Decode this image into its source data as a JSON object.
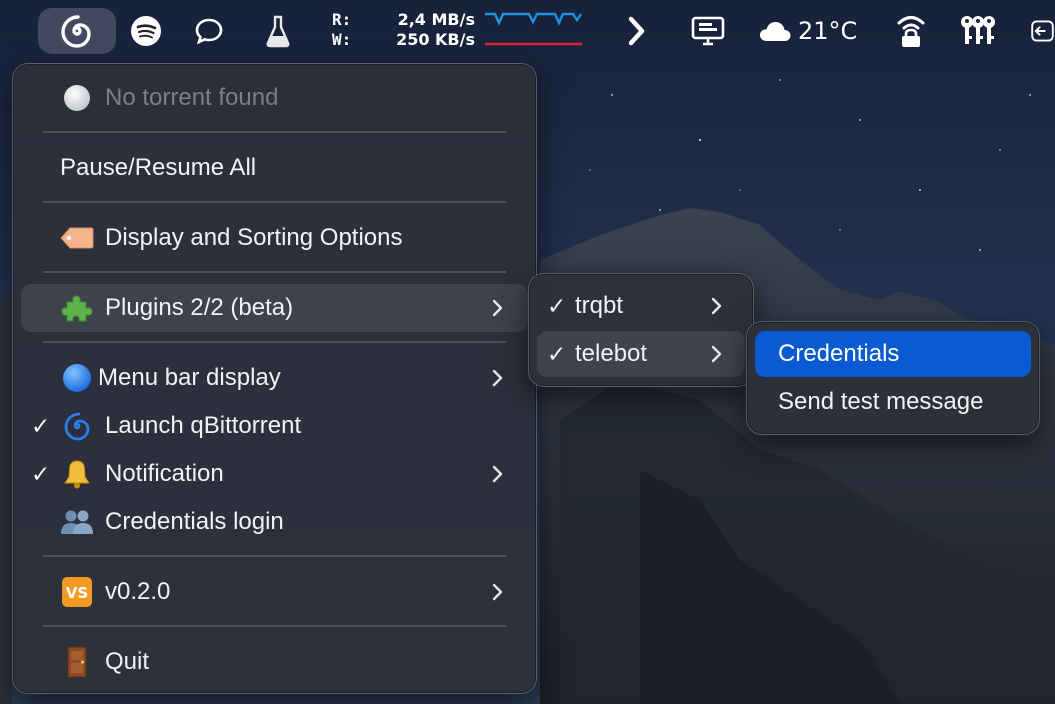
{
  "menubar": {
    "items": [
      {
        "name": "qbittorrent-status-icon",
        "active": true
      },
      {
        "name": "spotify-icon"
      },
      {
        "name": "chat-bubble-icon"
      },
      {
        "name": "flask-icon"
      },
      {
        "name": "chevron-right-icon"
      },
      {
        "name": "monitor-icon"
      },
      {
        "name": "cloud-icon"
      },
      {
        "name": "wifi-lock-icon"
      },
      {
        "name": "keys-icon"
      },
      {
        "name": "logout-icon"
      }
    ],
    "speed": {
      "read_label": "R:",
      "write_label": "W:",
      "read_value": "2,4 MB/s",
      "write_value": "250 KB/s",
      "read_color": "#1f8fe0",
      "write_color": "#e0242c"
    },
    "weather": {
      "temperature": "21°C",
      "icon": "cloud-icon"
    }
  },
  "main_menu": {
    "items": [
      {
        "label": "No torrent found",
        "icon": "white-circle-icon",
        "disabled": true
      },
      {
        "label": "Pause/Resume All"
      },
      {
        "label": "Display and Sorting Options",
        "icon": "label-tag-icon"
      },
      {
        "label": "Plugins 2/2 (beta)",
        "icon": "puzzle-piece-icon",
        "submenu": true,
        "highlighted": true
      },
      {
        "label": "Menu bar display",
        "icon": "blue-circle-icon",
        "submenu": true
      },
      {
        "label": "Launch qBittorrent",
        "icon": "cyclone-icon",
        "checked": true
      },
      {
        "label": "Notification",
        "icon": "bell-icon",
        "checked": true,
        "submenu": true
      },
      {
        "label": "Credentials login",
        "icon": "people-icon"
      },
      {
        "label": "v0.2.0",
        "icon": "vs-badge-icon",
        "submenu": true
      },
      {
        "label": "Quit",
        "icon": "door-icon"
      }
    ]
  },
  "plugins_submenu": {
    "items": [
      {
        "label": "trqbt",
        "checked": true,
        "submenu": true
      },
      {
        "label": "telebot",
        "checked": true,
        "submenu": true,
        "highlighted": true
      }
    ]
  },
  "telebot_submenu": {
    "items": [
      {
        "label": "Credentials",
        "selected": true
      },
      {
        "label": "Send test message"
      }
    ]
  },
  "glyphs": {
    "check": "✓",
    "vs_badge": "VS"
  },
  "colors": {
    "selection": "#0a5bd1",
    "menu_bg": "#2c303a",
    "disabled_text": "#7c7f88"
  }
}
